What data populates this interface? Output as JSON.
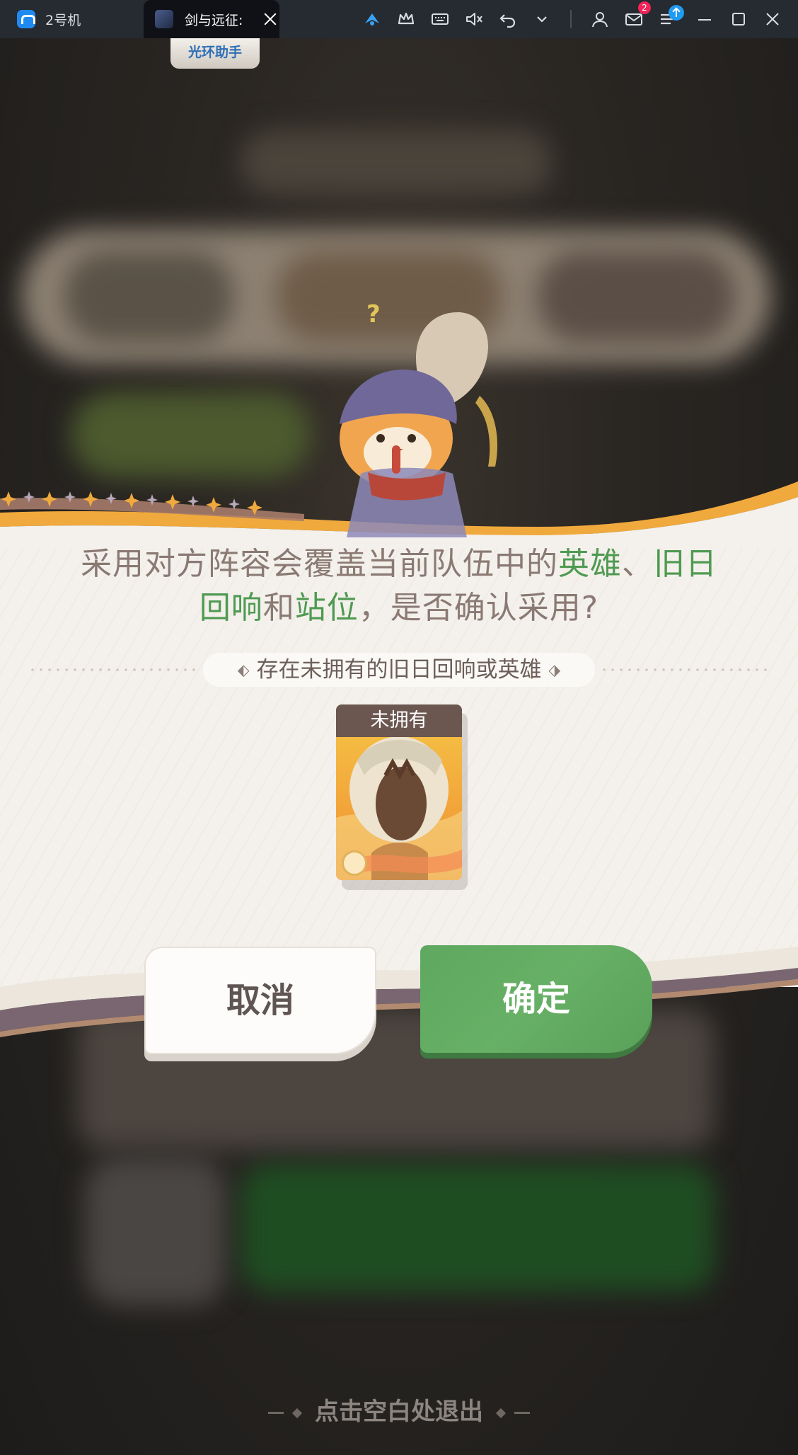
{
  "window": {
    "home_tab_label": "2号机",
    "game_tab_label": "剑与远征:",
    "mail_badge_count": "2"
  },
  "toolbar": {
    "icons": [
      "operation-icon",
      "crown-icon",
      "keyboard-icon",
      "mute-icon",
      "back-icon",
      "chevron-down-icon",
      "account-icon",
      "mail-icon",
      "menu-icon",
      "minimize-icon",
      "maximize-icon",
      "close-icon"
    ]
  },
  "overlay": {
    "helper_label": "光环助手",
    "prompt_part1": "采用对方阵容会覆盖当前队伍中的",
    "prompt_hl1": "英雄",
    "prompt_sep": "、",
    "prompt_hl2": "旧日回响",
    "prompt_and": "和",
    "prompt_hl3": "站位",
    "prompt_part2": "，是否确认采用?",
    "notice": "存在未拥有的旧日回响或英雄",
    "card_label": "未拥有",
    "cancel_label": "取消",
    "confirm_label": "确定",
    "exit_hint": "点击空白处退出",
    "question_mark": "?"
  },
  "colors": {
    "highlight": "#4f9a52",
    "prompt_text": "#8a7a73",
    "confirm_button": "#5ea85f",
    "accent_orange": "#f2a43a"
  }
}
